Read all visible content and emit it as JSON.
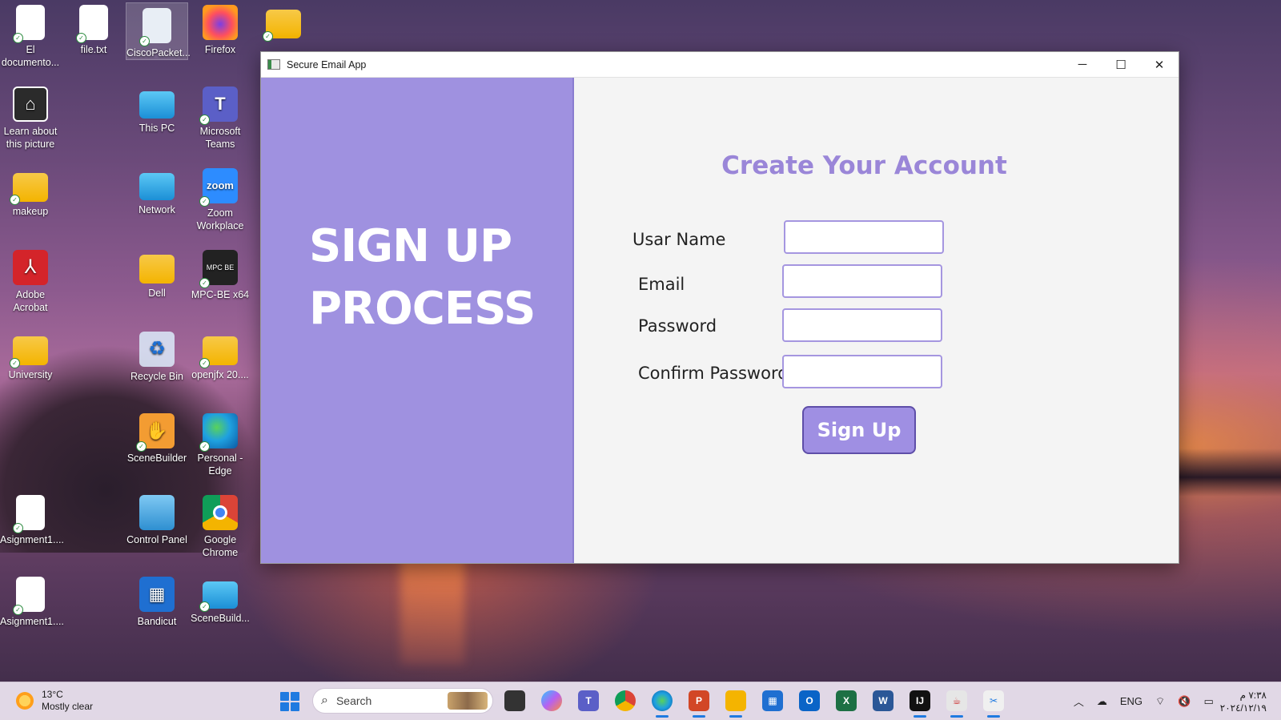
{
  "desktop": {
    "icons": [
      {
        "label": "El documento...",
        "icon": "edge-document-icon"
      },
      {
        "label": "file.txt",
        "icon": "text-file-icon"
      },
      {
        "label": "CiscoPacket...",
        "icon": "cisco-packet-tracer-icon"
      },
      {
        "label": "Firefox",
        "icon": "firefox-icon"
      },
      {
        "label": "Learn about this picture",
        "icon": "learn-picture-icon"
      },
      {
        "label": "This PC",
        "icon": "this-pc-icon"
      },
      {
        "label": "Microsoft Teams",
        "icon": "teams-icon"
      },
      {
        "label": "makeup",
        "icon": "folder-icon"
      },
      {
        "label": "Network",
        "icon": "network-icon"
      },
      {
        "label": "Zoom Workplace",
        "icon": "zoom-icon"
      },
      {
        "label": "Adobe Acrobat",
        "icon": "acrobat-icon"
      },
      {
        "label": "Dell",
        "icon": "folder-icon"
      },
      {
        "label": "MPC-BE x64",
        "icon": "mpc-be-icon"
      },
      {
        "label": "University",
        "icon": "folder-icon"
      },
      {
        "label": "Recycle Bin",
        "icon": "recycle-bin-icon"
      },
      {
        "label": "openjfx 20....",
        "icon": "folder-icon"
      },
      {
        "label": "SceneBuilder",
        "icon": "scenebuilder-icon"
      },
      {
        "label": "Personal - Edge",
        "icon": "edge-icon"
      },
      {
        "label": "Asignment1....",
        "icon": "word-document-icon"
      },
      {
        "label": "Control Panel",
        "icon": "control-panel-icon"
      },
      {
        "label": "Google Chrome",
        "icon": "chrome-icon"
      },
      {
        "label": "Asignment1....",
        "icon": "edge-document-icon"
      },
      {
        "label": "Bandicut",
        "icon": "bandicut-icon"
      },
      {
        "label": "SceneBuild...",
        "icon": "scenebuilder-installer-icon"
      }
    ]
  },
  "window": {
    "title": "Secure Email App",
    "minimize_glyph": "─",
    "maximize_glyph": "☐",
    "close_glyph": "✕"
  },
  "left_pane": {
    "heading_line1": "SIGN UP",
    "heading_line2": "PROCESS",
    "background": "#9f91e0"
  },
  "form": {
    "title": "Create Your Account",
    "fields": [
      {
        "label": "Usar Name",
        "value": "",
        "placeholder": ""
      },
      {
        "label": "Email",
        "value": "",
        "placeholder": ""
      },
      {
        "label": "Password",
        "value": "",
        "placeholder": ""
      },
      {
        "label": "Confirm Password",
        "value": "",
        "placeholder": ""
      }
    ],
    "submit_label": "Sign Up",
    "accent": "#9a86d8"
  },
  "taskbar": {
    "weather_temp": "13°C",
    "weather_desc": "Mostly clear",
    "search_placeholder": "Search",
    "apps": [
      "file-explorer-icon",
      "copilot-icon",
      "teams-icon",
      "chrome-icon",
      "edge-icon",
      "powerpoint-icon",
      "folder-icon",
      "store-icon",
      "outlook-icon",
      "excel-icon",
      "word-icon",
      "intellij-icon",
      "java-app-icon",
      "snipping-tool-icon"
    ],
    "language": "ENG",
    "time": "٧:٣٨ م",
    "date": "٢٠٢٤/١٢/١٩"
  }
}
